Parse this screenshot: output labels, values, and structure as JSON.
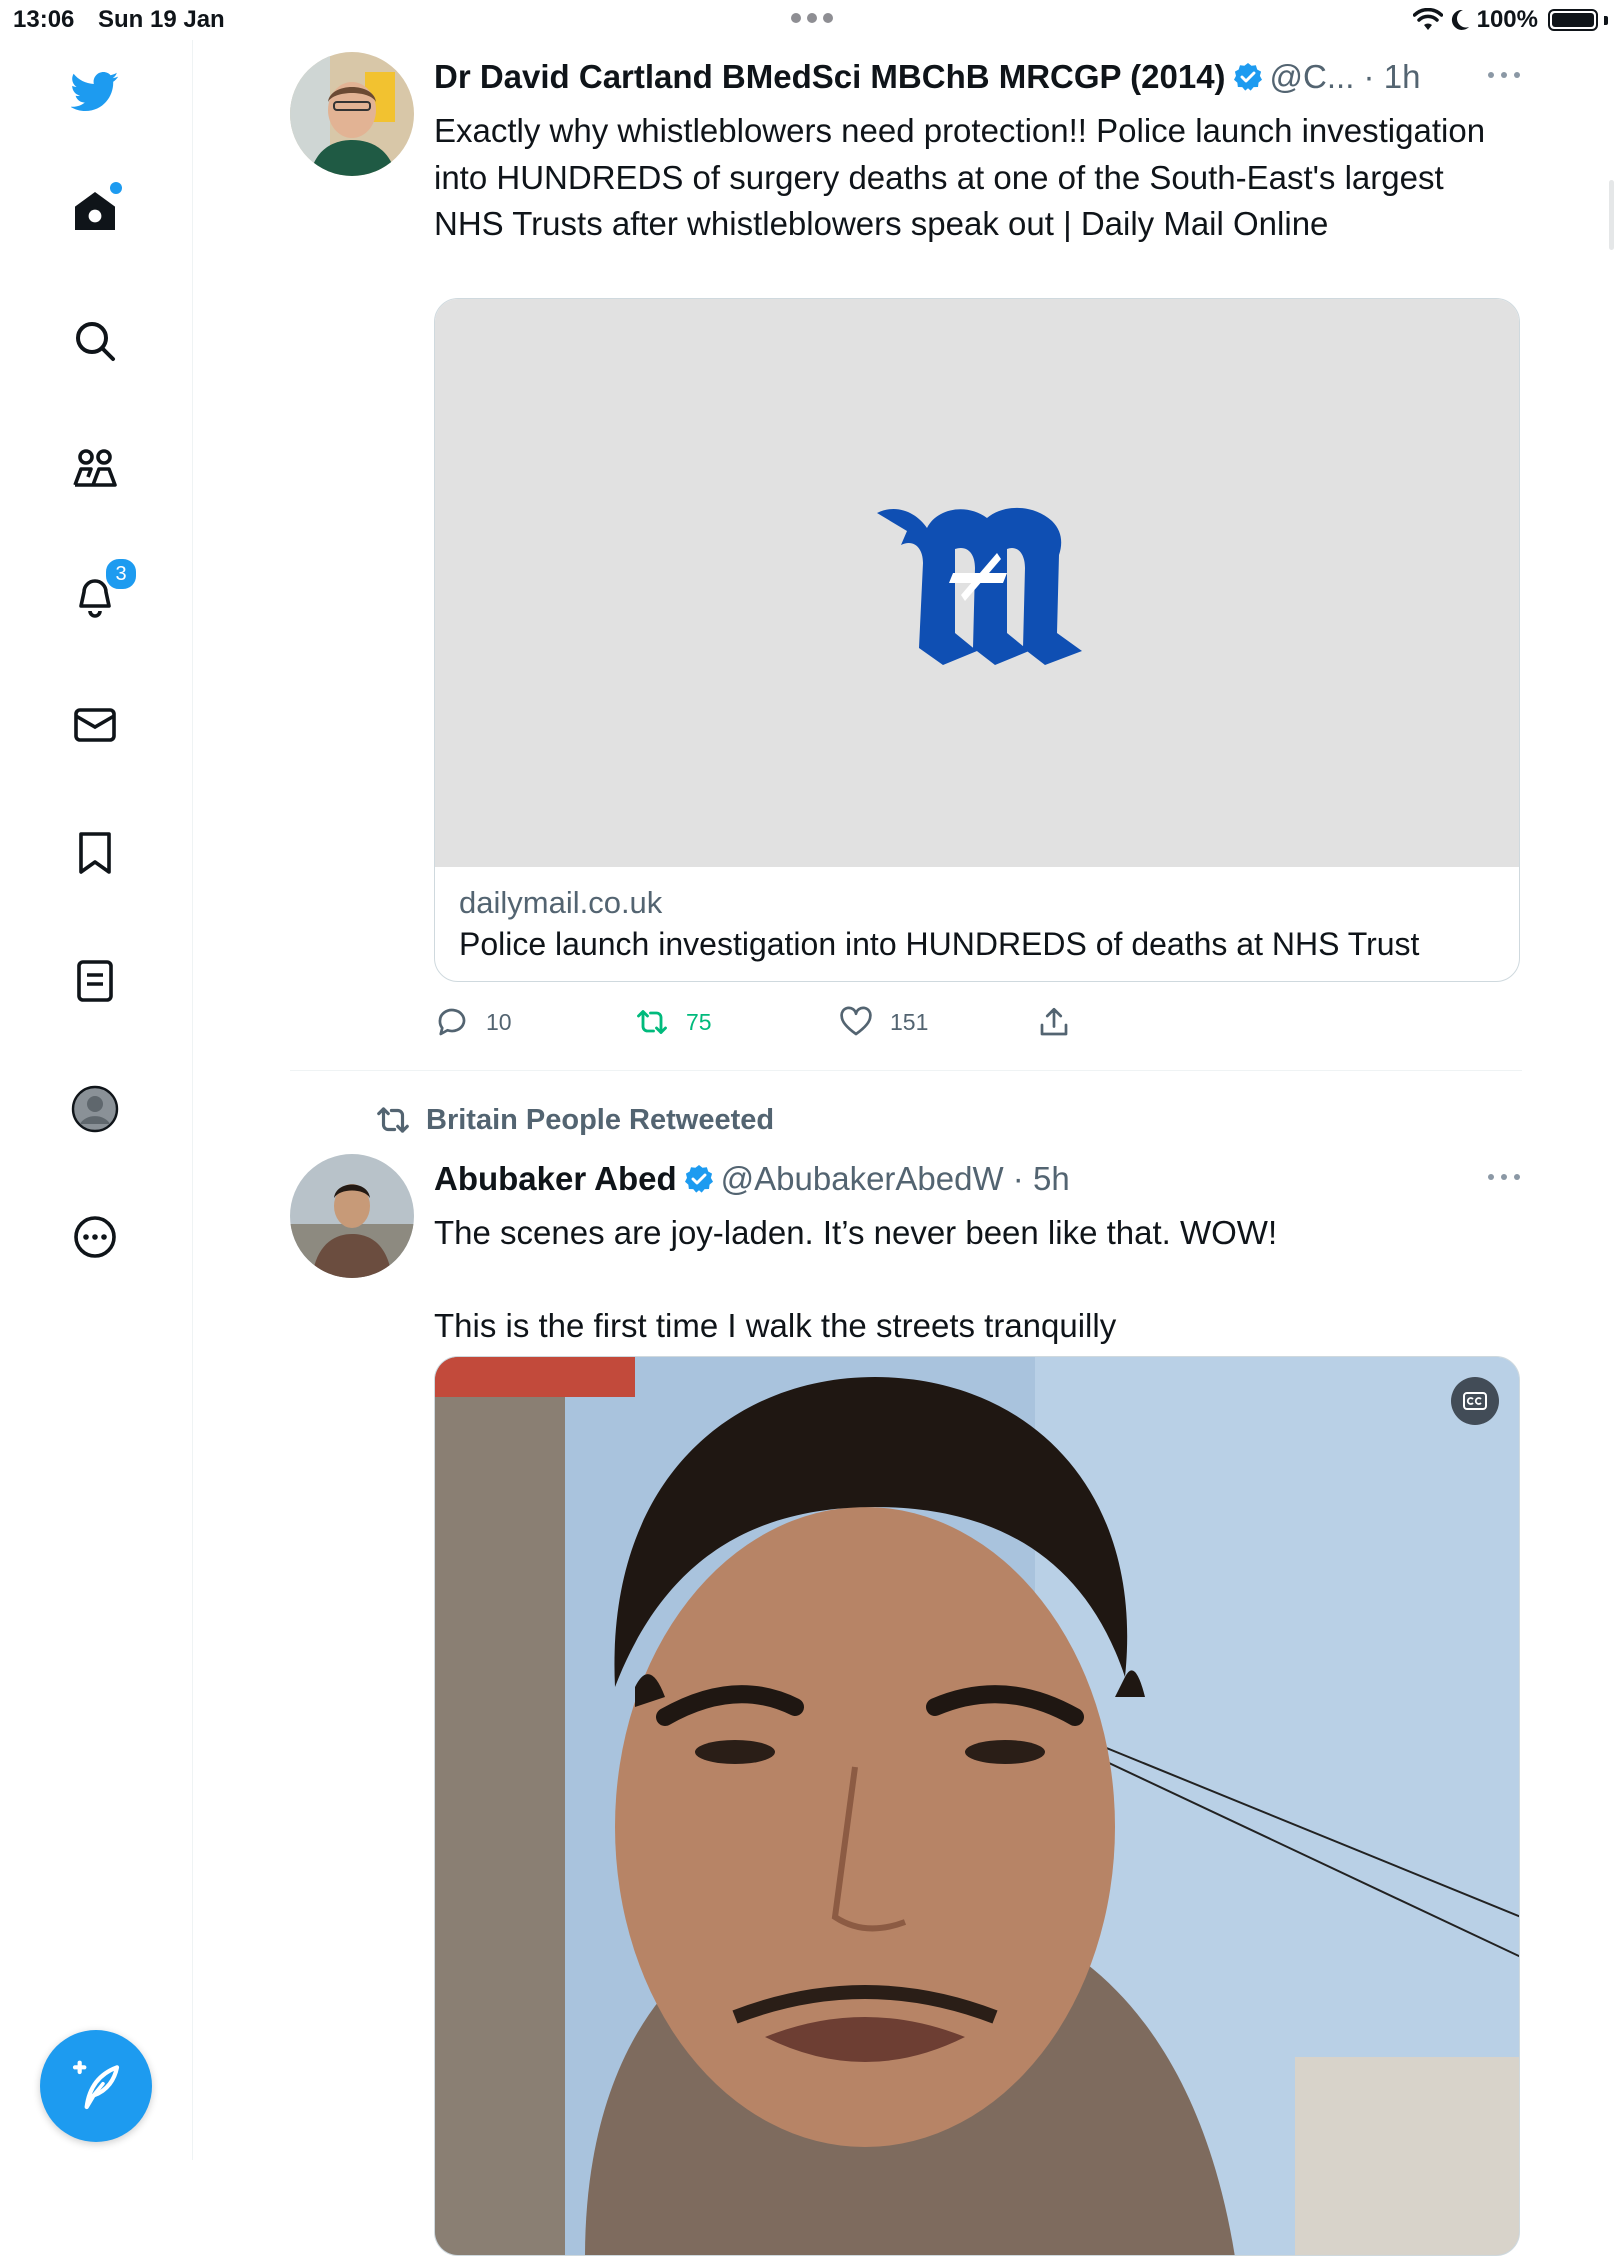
{
  "status_bar": {
    "time": "13:06",
    "date": "Sun 19 Jan",
    "battery": "100%"
  },
  "sidebar": {
    "items": [
      {
        "name": "home",
        "icon": "home-icon"
      },
      {
        "name": "search",
        "icon": "search-icon"
      },
      {
        "name": "communities",
        "icon": "communities-icon"
      },
      {
        "name": "notifications",
        "icon": "bell-icon",
        "badge": "3"
      },
      {
        "name": "messages",
        "icon": "mail-icon"
      },
      {
        "name": "bookmarks",
        "icon": "bookmark-icon"
      },
      {
        "name": "lists",
        "icon": "list-icon"
      },
      {
        "name": "profile",
        "icon": "avatar-icon"
      },
      {
        "name": "more",
        "icon": "more-circle-icon"
      }
    ],
    "compose_icon": "feather-plus-icon"
  },
  "colors": {
    "accent": "#1d9bf0",
    "retweet": "#00ba7c",
    "muted": "#536471",
    "daily_mail_blue": "#0f4fb3"
  },
  "tweets": [
    {
      "author": "Dr David Cartland BMedSci MBChB MRCGP (2014)",
      "handle": "@C...",
      "time": "1h",
      "text": "Exactly why whistleblowers need protection!! Police launch investigation into HUNDREDS of surgery deaths at one of the South-East's largest NHS Trusts after whistleblowers speak out | Daily Mail Online",
      "card": {
        "domain": "dailymail.co.uk",
        "title": "Police launch investigation into HUNDREDS of deaths at NHS Trust",
        "logo_letter": "M"
      },
      "actions": {
        "replies": "10",
        "retweets": "75",
        "likes": "151"
      }
    },
    {
      "retweeted_by": "Britain People Retweeted",
      "author": "Abubaker Abed",
      "handle": "@AbubakerAbedW",
      "time": "5h",
      "text": "The scenes are joy-laden. It’s never been like that. WOW!\n\nThis is the first time I walk the streets tranquilly"
    }
  ]
}
